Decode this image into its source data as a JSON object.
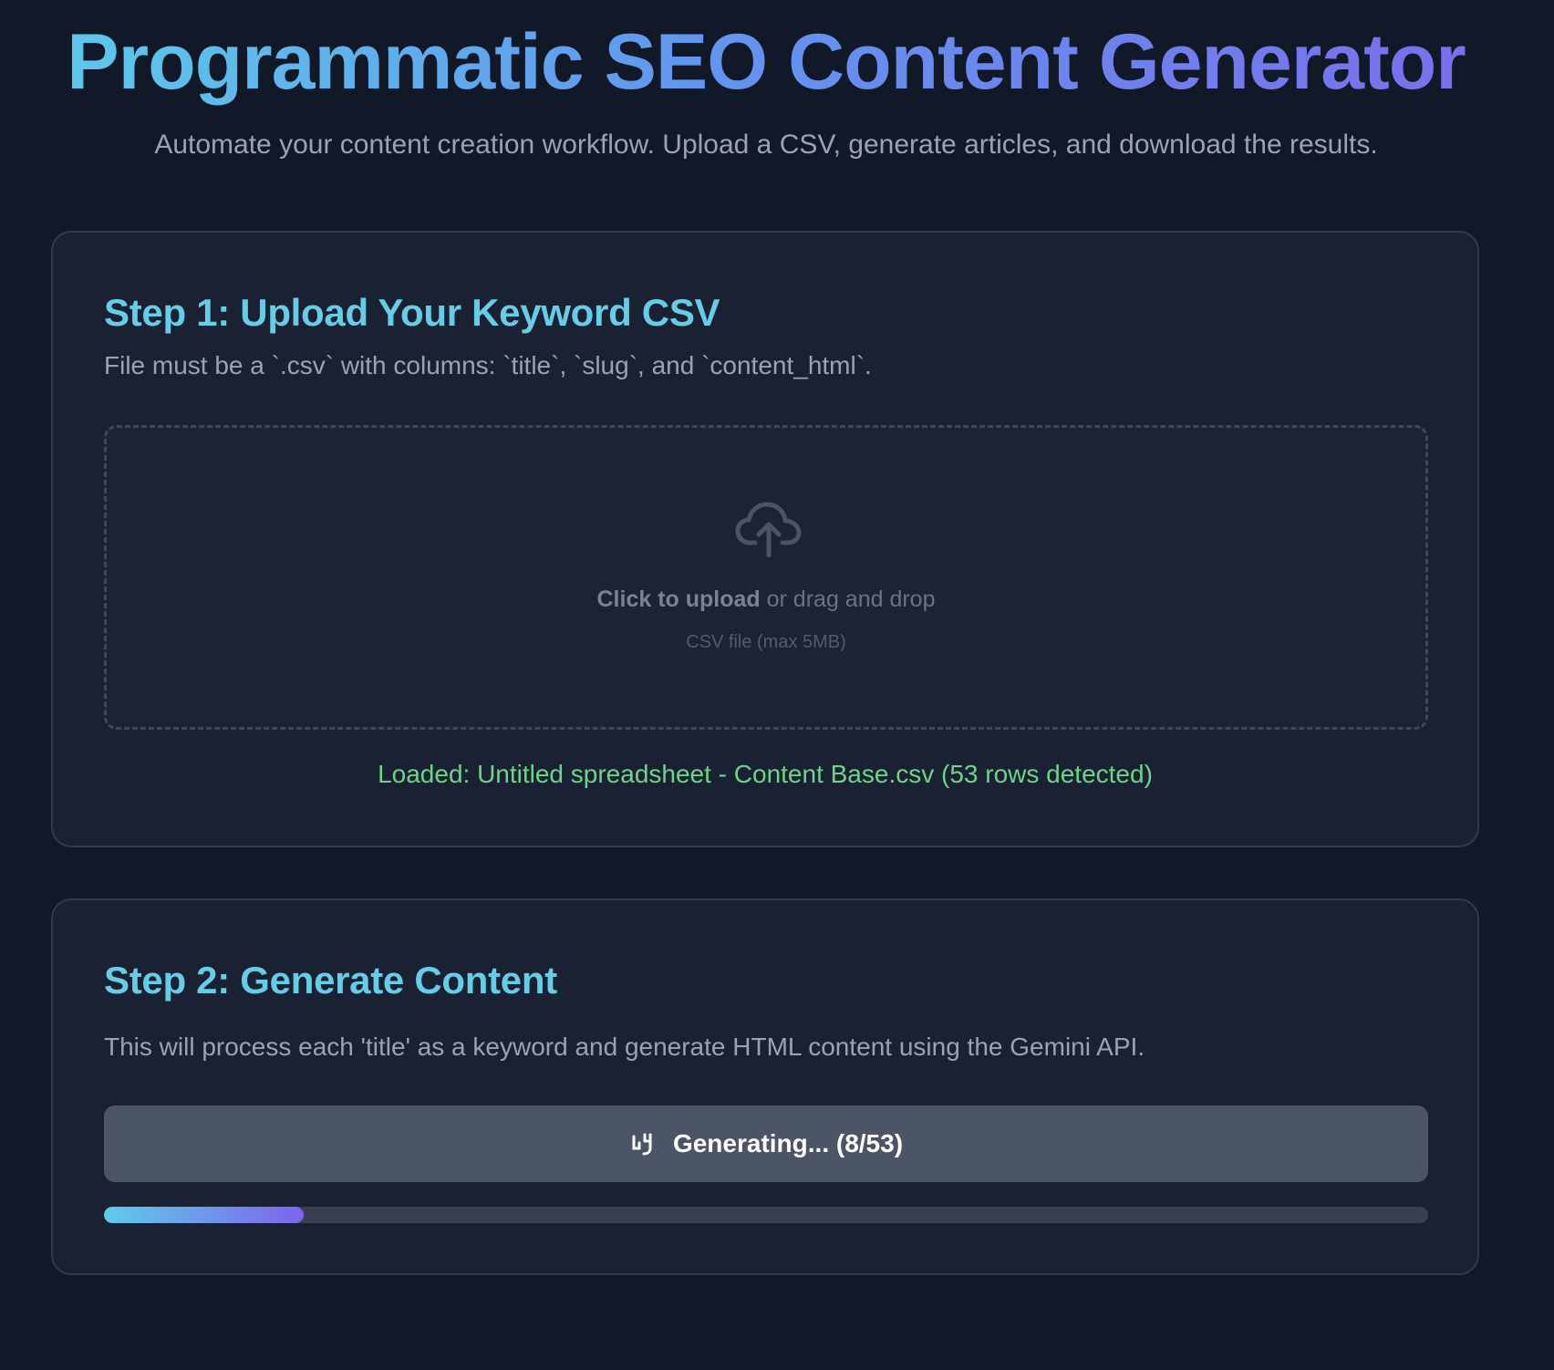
{
  "header": {
    "title": "Programmatic SEO Content Generator",
    "subtitle": "Automate your content creation workflow. Upload a CSV, generate articles, and download the results."
  },
  "step1": {
    "title": "Step 1: Upload Your Keyword CSV",
    "description": "File must be a `.csv` with columns: `title`, `slug`, and `content_html`.",
    "dropzone": {
      "icon": "cloud-upload-icon",
      "action_label": "Click to upload",
      "action_suffix": " or drag and drop",
      "hint": "CSV file (max 5MB)"
    },
    "status": "Loaded: Untitled spreadsheet - Content Base.csv (53 rows detected)"
  },
  "step2": {
    "title": "Step 2: Generate Content",
    "description": "This will process each 'title' as a keyword and generate HTML content using the Gemini API.",
    "button": {
      "icon": "spinner-icon",
      "label": "Generating... (8/53)"
    },
    "progress": {
      "completed": 8,
      "total": 53
    }
  },
  "colors": {
    "background": "#111827",
    "card": "#1a2132",
    "accent": "#67cde6",
    "success": "#6fd38a",
    "gradient_start": "#5ecce9",
    "gradient_end": "#7e63ec"
  }
}
